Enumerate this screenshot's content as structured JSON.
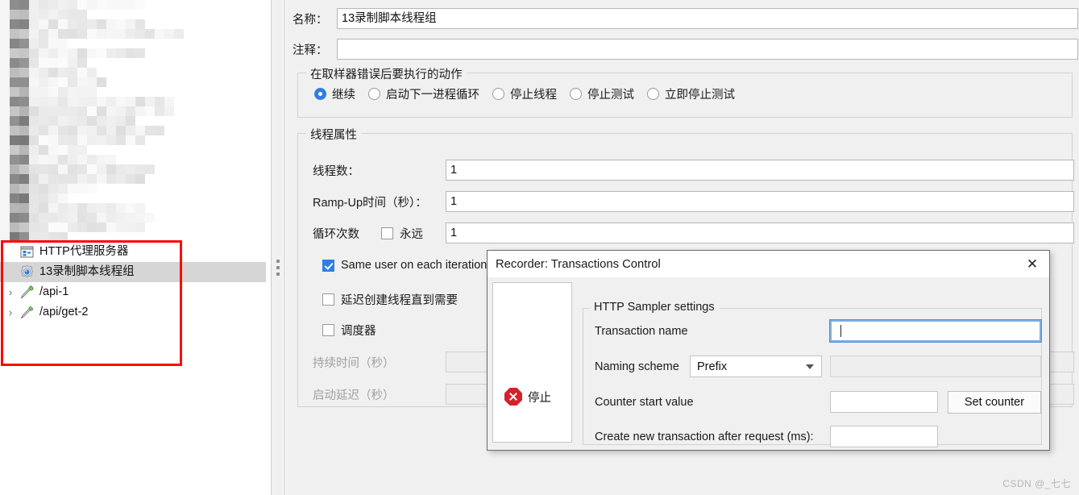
{
  "tree": {
    "items": [
      {
        "label": "HTTP代理服务器",
        "icon": "http-proxy-icon",
        "selected": false,
        "toggle": "",
        "indent": 0
      },
      {
        "label": "13录制脚本线程组",
        "icon": "gear-icon",
        "selected": true,
        "toggle": "",
        "indent": 0
      },
      {
        "label": "/api-1",
        "icon": "sampler-icon",
        "selected": false,
        "toggle": "›",
        "indent": 0
      },
      {
        "label": "/api/get-2",
        "icon": "sampler-icon",
        "selected": false,
        "toggle": "›",
        "indent": 0
      }
    ],
    "highlight_color": "#fa0a0a"
  },
  "main": {
    "name_label": "名称：",
    "name_value": "13录制脚本线程组",
    "comment_label": "注释：",
    "comment_value": "",
    "error_action": {
      "title": "在取样器错误后要执行的动作",
      "options": [
        {
          "label": "继续",
          "selected": true
        },
        {
          "label": "启动下一进程循环",
          "selected": false
        },
        {
          "label": "停止线程",
          "selected": false
        },
        {
          "label": "停止测试",
          "selected": false
        },
        {
          "label": "立即停止测试",
          "selected": false
        }
      ]
    },
    "thread_props": {
      "title": "线程属性",
      "threads_label": "线程数：",
      "threads_value": "1",
      "rampup_label": "Ramp-Up时间（秒）：",
      "rampup_value": "1",
      "loops_label": "循环次数",
      "forever_label": "永远",
      "forever_checked": false,
      "loops_value": "1",
      "same_user_label": "Same user on each iteration",
      "same_user_checked": true,
      "delay_create_label": "延迟创建线程直到需要",
      "delay_create_checked": false,
      "scheduler_label": "调度器",
      "scheduler_checked": false,
      "duration_label": "持续时间（秒）",
      "duration_value": "",
      "startup_delay_label": "启动延迟（秒）",
      "startup_delay_value": ""
    }
  },
  "dialog": {
    "title": "Recorder: Transactions Control",
    "close_icon": "✕",
    "stop_button_label": "停止",
    "stop_icon": "stop-octagon-icon",
    "group_title": "HTTP Sampler settings",
    "transaction_name_label": "Transaction name",
    "transaction_name_value": "",
    "naming_scheme_label": "Naming scheme",
    "naming_scheme_value": "Prefix",
    "naming_scheme_options": [
      "Prefix"
    ],
    "naming_suffix_value": "",
    "counter_start_label": "Counter start value",
    "counter_start_value": "",
    "set_counter_label": "Set counter",
    "create_new_label": "Create new transaction after request (ms):",
    "create_new_value": ""
  },
  "watermark": "CSDN @_七七"
}
